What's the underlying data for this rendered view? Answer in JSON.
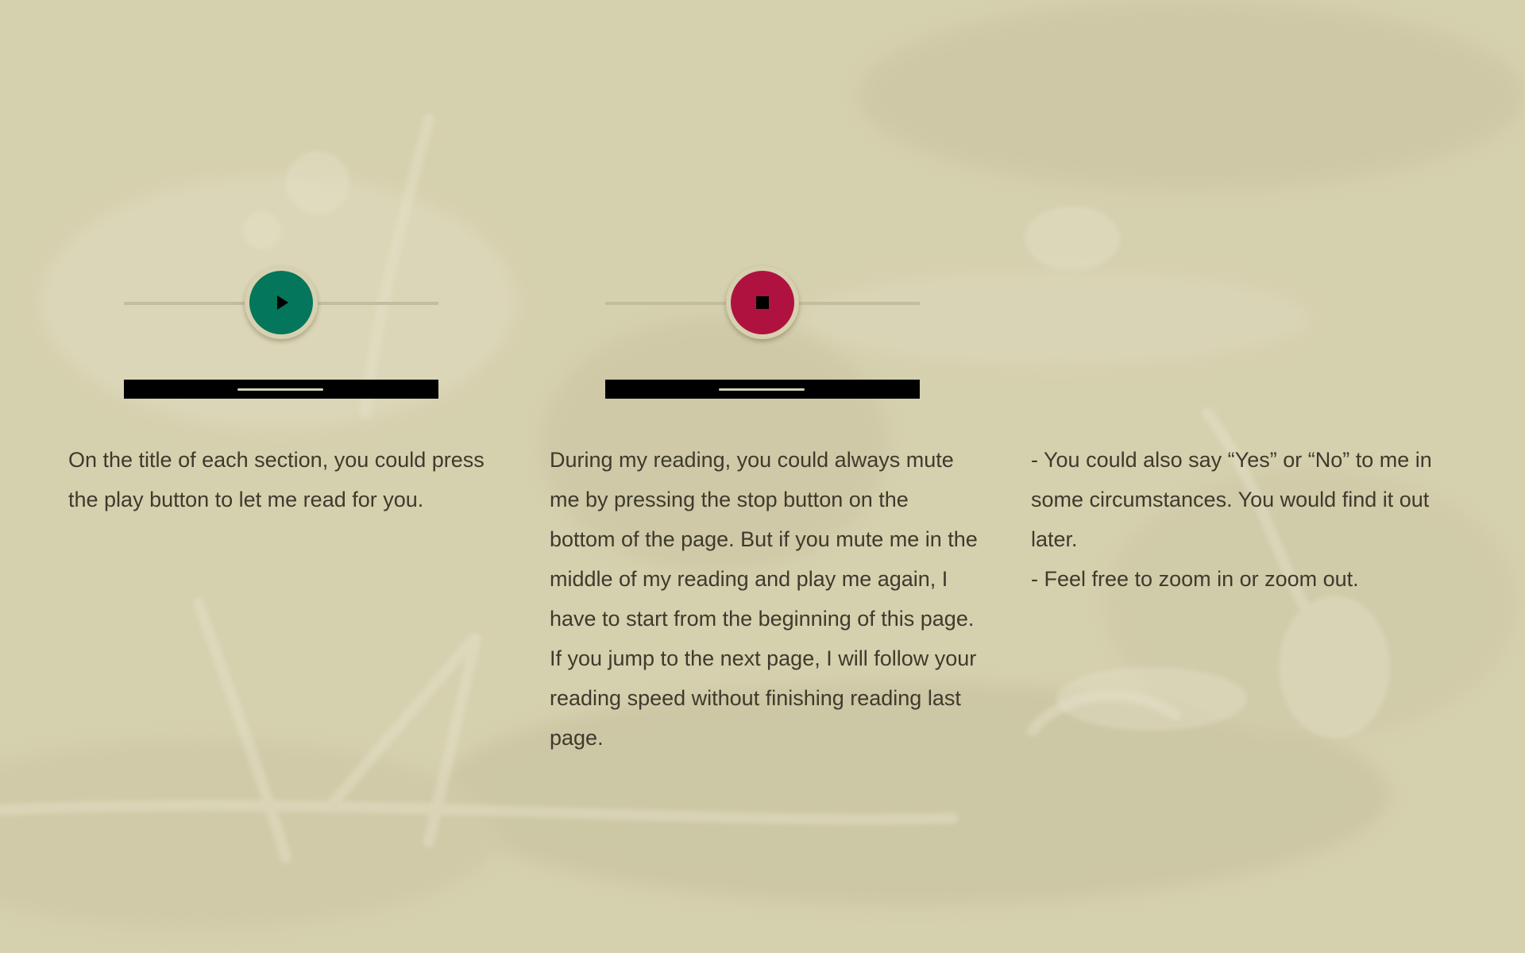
{
  "theme": {
    "background": "#d6d1b0",
    "play_color": "#03765b",
    "stop_color": "#b0123f",
    "text_color": "#3e3a2c"
  },
  "panels": [
    {
      "button": "play",
      "icon": "play-icon",
      "text": "On the title of each section, you could press the play button to let me read for you."
    },
    {
      "button": "stop",
      "icon": "stop-icon",
      "text": "During my reading, you could always mute me by pressing the stop button on the bottom of the page. But if you mute me in the middle of my reading and play me again, I have to start from the beginning of this page. If you jump to the next page, I will follow your reading speed without finishing reading last page."
    },
    {
      "text": " - You could also say “Yes” or “No” to me in some circumstances. You would find it out later.\n- Feel free to zoom in or zoom out."
    }
  ]
}
